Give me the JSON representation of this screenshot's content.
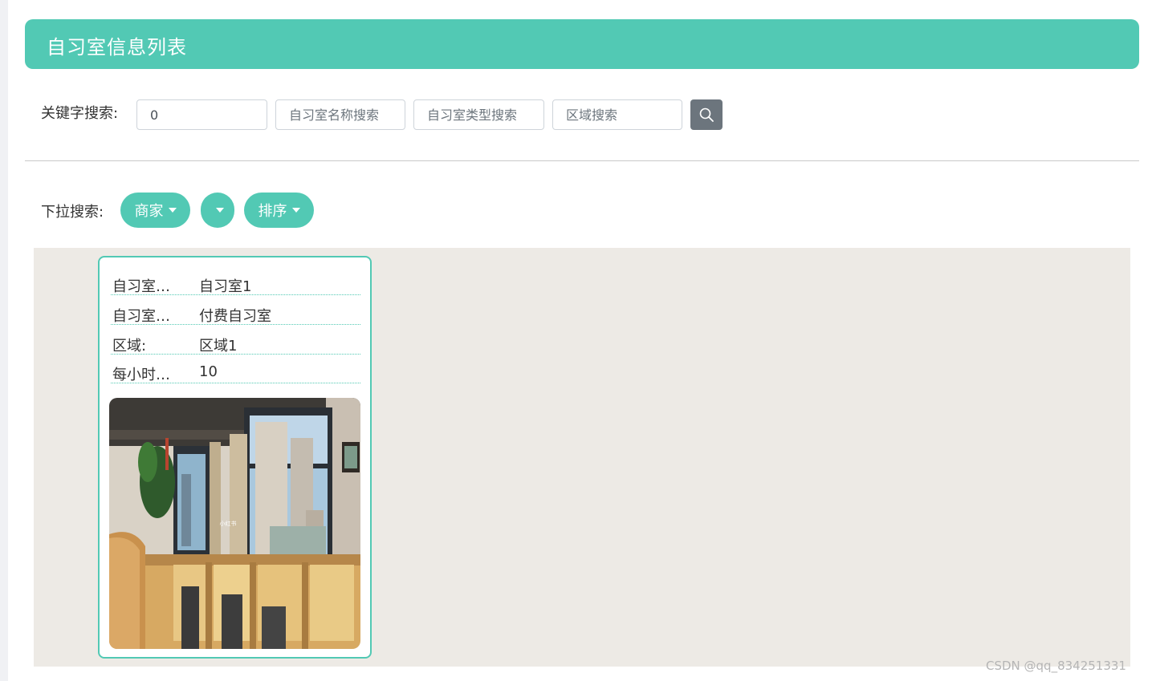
{
  "header": {
    "title": "自习室信息列表"
  },
  "search": {
    "label": "关键字搜索:",
    "inputs": [
      {
        "value": "0",
        "placeholder": ""
      },
      {
        "value": "",
        "placeholder": "自习室名称搜索"
      },
      {
        "value": "",
        "placeholder": "自习室类型搜索"
      },
      {
        "value": "",
        "placeholder": "区域搜索"
      }
    ],
    "button_icon": "search-icon"
  },
  "dropdowns": {
    "label": "下拉搜索:",
    "items": [
      {
        "label": "商家"
      },
      {
        "label": ""
      },
      {
        "label": "排序"
      }
    ]
  },
  "cards": [
    {
      "fields": [
        {
          "key": "自习室…",
          "value": "自习室1"
        },
        {
          "key": "自习室…",
          "value": "付费自习室"
        },
        {
          "key": "区域:",
          "value": "区域1"
        },
        {
          "key": "每小时…",
          "value": "10"
        }
      ],
      "image_caption": "小红书"
    }
  ],
  "watermark": "CSDN @qq_834251331",
  "colors": {
    "accent": "#52c9b4",
    "content_bg": "#edeae5",
    "button_gray": "#6c757d"
  }
}
